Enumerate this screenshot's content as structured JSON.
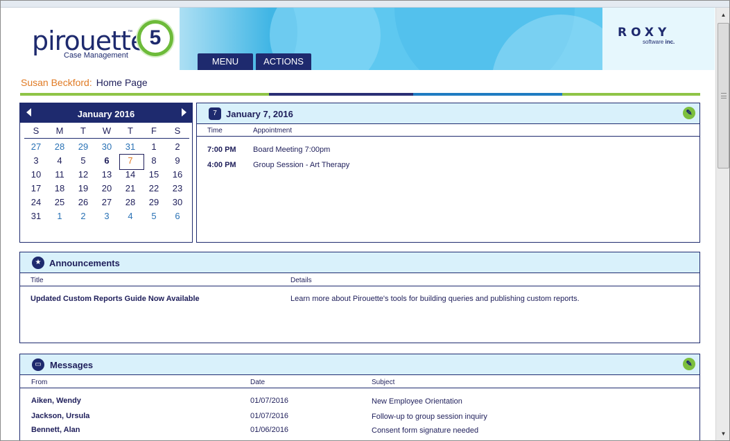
{
  "header": {
    "logo_word": "pirouette",
    "logo_tm": "™",
    "logo_subtitle": "Case Management",
    "logo_version": "5",
    "company_name": "ROXY",
    "company_sub_1": "software",
    "company_sub_2": "inc.",
    "nav": {
      "menu_label": "MENU",
      "actions_label": "ACTIONS"
    }
  },
  "breadcrumb": {
    "user": "Susan Beckford:",
    "page": "Home Page"
  },
  "calendar": {
    "month_year": "January  2016",
    "days_of_week": [
      "S",
      "M",
      "T",
      "W",
      "T",
      "F",
      "S"
    ],
    "weeks": [
      [
        "27",
        "28",
        "29",
        "30",
        "31",
        "1",
        "2"
      ],
      [
        "3",
        "4",
        "5",
        "6",
        "7",
        "8",
        "9"
      ],
      [
        "10",
        "11",
        "12",
        "13",
        "14",
        "15",
        "16"
      ],
      [
        "17",
        "18",
        "19",
        "20",
        "21",
        "22",
        "23"
      ],
      [
        "24",
        "25",
        "26",
        "27",
        "28",
        "29",
        "30"
      ],
      [
        "31",
        "1",
        "2",
        "3",
        "4",
        "5",
        "6"
      ]
    ],
    "selected_day": "7",
    "today_day": "6"
  },
  "appointments": {
    "title": "January 7, 2016",
    "columns": {
      "time": "Time",
      "appointment": "Appointment"
    },
    "rows": [
      {
        "time": "7:00 PM",
        "text": "Board Meeting 7:00pm"
      },
      {
        "time": "4:00 PM",
        "text": "Group Session - Art Therapy"
      }
    ]
  },
  "announcements": {
    "title": "Announcements",
    "columns": {
      "title": "Title",
      "details": "Details"
    },
    "rows": [
      {
        "title": "Updated Custom Reports Guide Now Available",
        "details": "Learn more about Pirouette's tools for building queries and publishing custom reports."
      }
    ]
  },
  "messages": {
    "title": "Messages",
    "columns": {
      "from": "From",
      "date": "Date",
      "subject": "Subject"
    },
    "rows": [
      {
        "from": "Aiken, Wendy",
        "date": "01/07/2016",
        "subject": "New Employee Orientation"
      },
      {
        "from": "Jackson, Ursula",
        "date": "01/07/2016",
        "subject": "Follow-up to group session inquiry"
      },
      {
        "from": "Bennett, Alan",
        "date": "01/06/2016",
        "subject": "Consent form signature needed"
      }
    ]
  },
  "colors": {
    "navy": "#1e2a6e",
    "accent_orange": "#e07a23",
    "accent_green": "#8fc447",
    "panel_header": "#d9f1fb",
    "header_blue": "#5ec8f0"
  },
  "icons": {
    "calendar_prev": "triangle-left-icon",
    "calendar_next": "triangle-right-icon",
    "appointments": "calendar-icon",
    "announcements": "star-icon",
    "messages": "chat-icon",
    "tools": "wrench-icon"
  }
}
